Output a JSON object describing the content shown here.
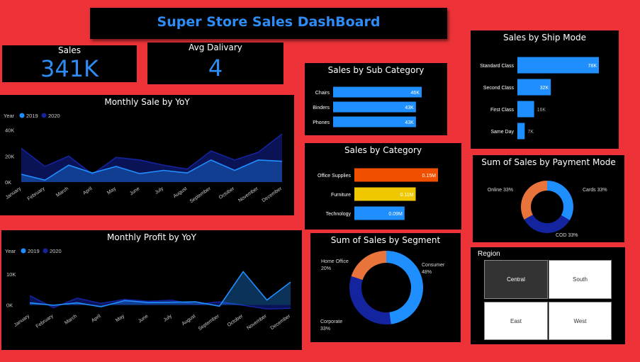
{
  "dashboard_title": "Super Store Sales DashBoard",
  "kpis": {
    "sales": {
      "label": "Sales",
      "value": "341K"
    },
    "delivery": {
      "label": "Avg Dalivary",
      "value": "4"
    }
  },
  "colors": {
    "blue": "#1f8fff",
    "navy": "#14239e",
    "orange": "#e8743b",
    "office": "#f04f00",
    "furniture": "#f0c800"
  },
  "region": {
    "title": "Region",
    "items": [
      "Central",
      "South",
      "East",
      "West"
    ],
    "selected": "Central"
  },
  "chart_data": [
    {
      "id": "sales_yoy",
      "type": "area",
      "title": "Monthly Sale by YoY",
      "legend_title": "Year",
      "x": [
        "January",
        "February",
        "March",
        "April",
        "May",
        "June",
        "July",
        "August",
        "September",
        "October",
        "November",
        "December"
      ],
      "y_ticks": [
        "0K",
        "20K",
        "40K"
      ],
      "ylim": [
        0,
        42000
      ],
      "series": [
        {
          "name": "2019",
          "color": "#1f8fff",
          "values": [
            6000,
            1500,
            13000,
            7000,
            12000,
            6500,
            9000,
            7000,
            17000,
            9000,
            17000,
            16000
          ]
        },
        {
          "name": "2020",
          "color": "#14239e",
          "values": [
            26000,
            12000,
            20000,
            6000,
            19000,
            17000,
            13000,
            10000,
            24000,
            17000,
            23000,
            37000
          ]
        }
      ]
    },
    {
      "id": "profit_yoy",
      "type": "area",
      "title": "Monthly Profit by YoY",
      "legend_title": "Year",
      "x": [
        "January",
        "February",
        "March",
        "April",
        "May",
        "June",
        "July",
        "August",
        "September",
        "October",
        "November",
        "December"
      ],
      "y_ticks": [
        "0K",
        "10K"
      ],
      "ylim": [
        -1500,
        12500
      ],
      "series": [
        {
          "name": "2019",
          "color": "#1f8fff",
          "values": [
            700,
            -100,
            700,
            -600,
            1400,
            800,
            900,
            1000,
            -400,
            10800,
            1600,
            7400
          ]
        },
        {
          "name": "2020",
          "color": "#14239e",
          "values": [
            3000,
            -900,
            2200,
            500,
            1800,
            1200,
            1500,
            200,
            1000,
            -100,
            -1300,
            -1100
          ]
        }
      ]
    },
    {
      "id": "sub_category",
      "type": "bar",
      "orientation": "horizontal",
      "title": "Sales by Sub Category",
      "categories": [
        "Chairs",
        "Binders",
        "Phones"
      ],
      "values": [
        46000,
        43000,
        43000
      ],
      "labels": [
        "46K",
        "43K",
        "43K"
      ],
      "colors": [
        "#1f8fff",
        "#1f8fff",
        "#1f8fff"
      ],
      "xmax": 46000
    },
    {
      "id": "category",
      "type": "bar",
      "orientation": "horizontal",
      "title": "Sales by Category",
      "categories": [
        "Office Supplies",
        "Furniture",
        "Technology"
      ],
      "values": [
        150000,
        110000,
        90000
      ],
      "labels": [
        "0.15M",
        "0.11M",
        "0.09M"
      ],
      "colors": [
        "#f04f00",
        "#f0c800",
        "#1f8fff"
      ],
      "xmax": 150000
    },
    {
      "id": "ship_mode",
      "type": "bar",
      "orientation": "horizontal",
      "title": "Sales by Ship Mode",
      "categories": [
        "Standard Class",
        "Second Class",
        "First Class",
        "Same Day"
      ],
      "values": [
        78000,
        32000,
        16000,
        7000
      ],
      "labels": [
        "78K",
        "32K",
        "16K",
        "7K"
      ],
      "colors": [
        "#1f8fff",
        "#1f8fff",
        "#1f8fff",
        "#1f8fff"
      ],
      "xmax": 78000
    },
    {
      "id": "payment_mode",
      "type": "pie",
      "donut": true,
      "title": "Sum of Sales by Payment Mode",
      "slices": [
        {
          "label": "Cards",
          "pct": "33%",
          "value": 33.5,
          "color": "#1f8fff"
        },
        {
          "label": "COD",
          "pct": "33%",
          "value": 33.5,
          "color": "#14239e"
        },
        {
          "label": "Online",
          "pct": "33%",
          "value": 33,
          "color": "#e8743b"
        }
      ]
    },
    {
      "id": "segment",
      "type": "pie",
      "donut": true,
      "title": "Sum of Sales by Segment",
      "slices": [
        {
          "label": "Consumer",
          "pct": "48%",
          "value": 48,
          "color": "#1f8fff"
        },
        {
          "label": "Corporate",
          "pct": "33%",
          "value": 32,
          "color": "#14239e"
        },
        {
          "label": "Home Office",
          "pct": "20%",
          "value": 20,
          "color": "#e8743b"
        }
      ]
    }
  ]
}
